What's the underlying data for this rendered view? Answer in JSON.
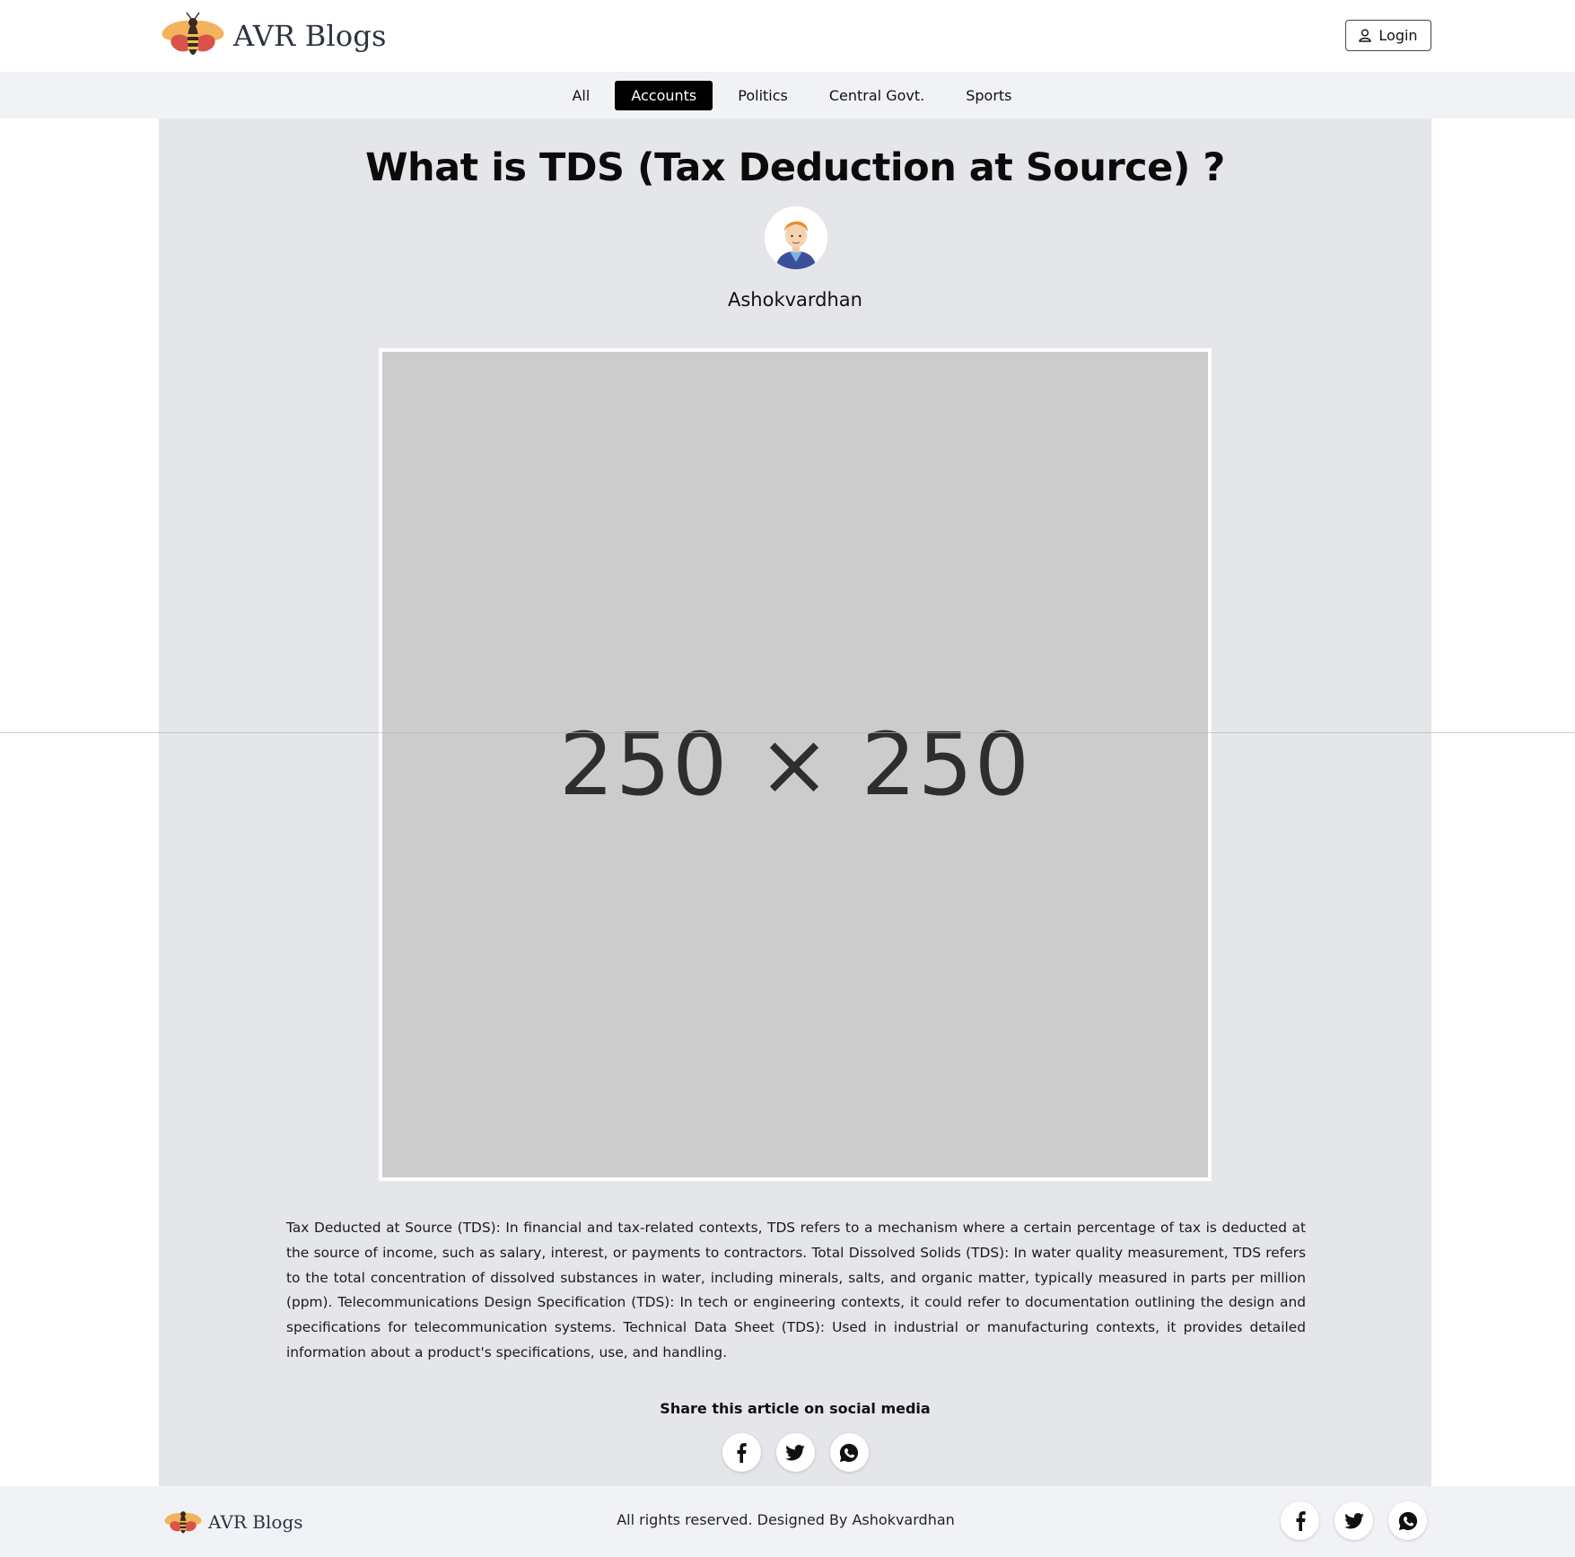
{
  "header": {
    "brand_name": "AVR Blogs",
    "login_label": "Login"
  },
  "categories": [
    {
      "label": "All",
      "active": false
    },
    {
      "label": "Accounts",
      "active": true
    },
    {
      "label": "Politics",
      "active": false
    },
    {
      "label": "Central Govt.",
      "active": false
    },
    {
      "label": "Sports",
      "active": false
    }
  ],
  "article": {
    "title": "What is TDS (Tax Deduction at Source) ?",
    "author": "Ashokvardhan",
    "image_placeholder_text": "250 × 250",
    "body": "Tax Deducted at Source (TDS): In financial and tax-related contexts, TDS refers to a mechanism where a certain percentage of tax is deducted at the source of income, such as salary, interest, or payments to contractors. Total Dissolved Solids (TDS): In water quality measurement, TDS refers to the total concentration of dissolved substances in water, including minerals, salts, and organic matter, typically measured in parts per million (ppm). Telecommunications Design Specification (TDS): In tech or engineering contexts, it could refer to documentation outlining the design and specifications for telecommunication systems. Technical Data Sheet (TDS): Used in industrial or manufacturing contexts, it provides detailed information about a product's specifications, use, and handling.",
    "share_title": "Share this article on social media"
  },
  "footer": {
    "brand_name": "AVR Blogs",
    "copyright": "All rights reserved. Designed By Ashokvardhan"
  },
  "icons": {
    "logo": "bee-logo-icon",
    "login": "user-icon",
    "share": [
      "facebook-icon",
      "twitter-icon",
      "whatsapp-icon"
    ]
  },
  "colors": {
    "active_category_bg": "#000000",
    "nav_bg": "#f0f2f6",
    "content_bg": "#e5e6ea",
    "image_placeholder_bg": "#cccccc"
  }
}
